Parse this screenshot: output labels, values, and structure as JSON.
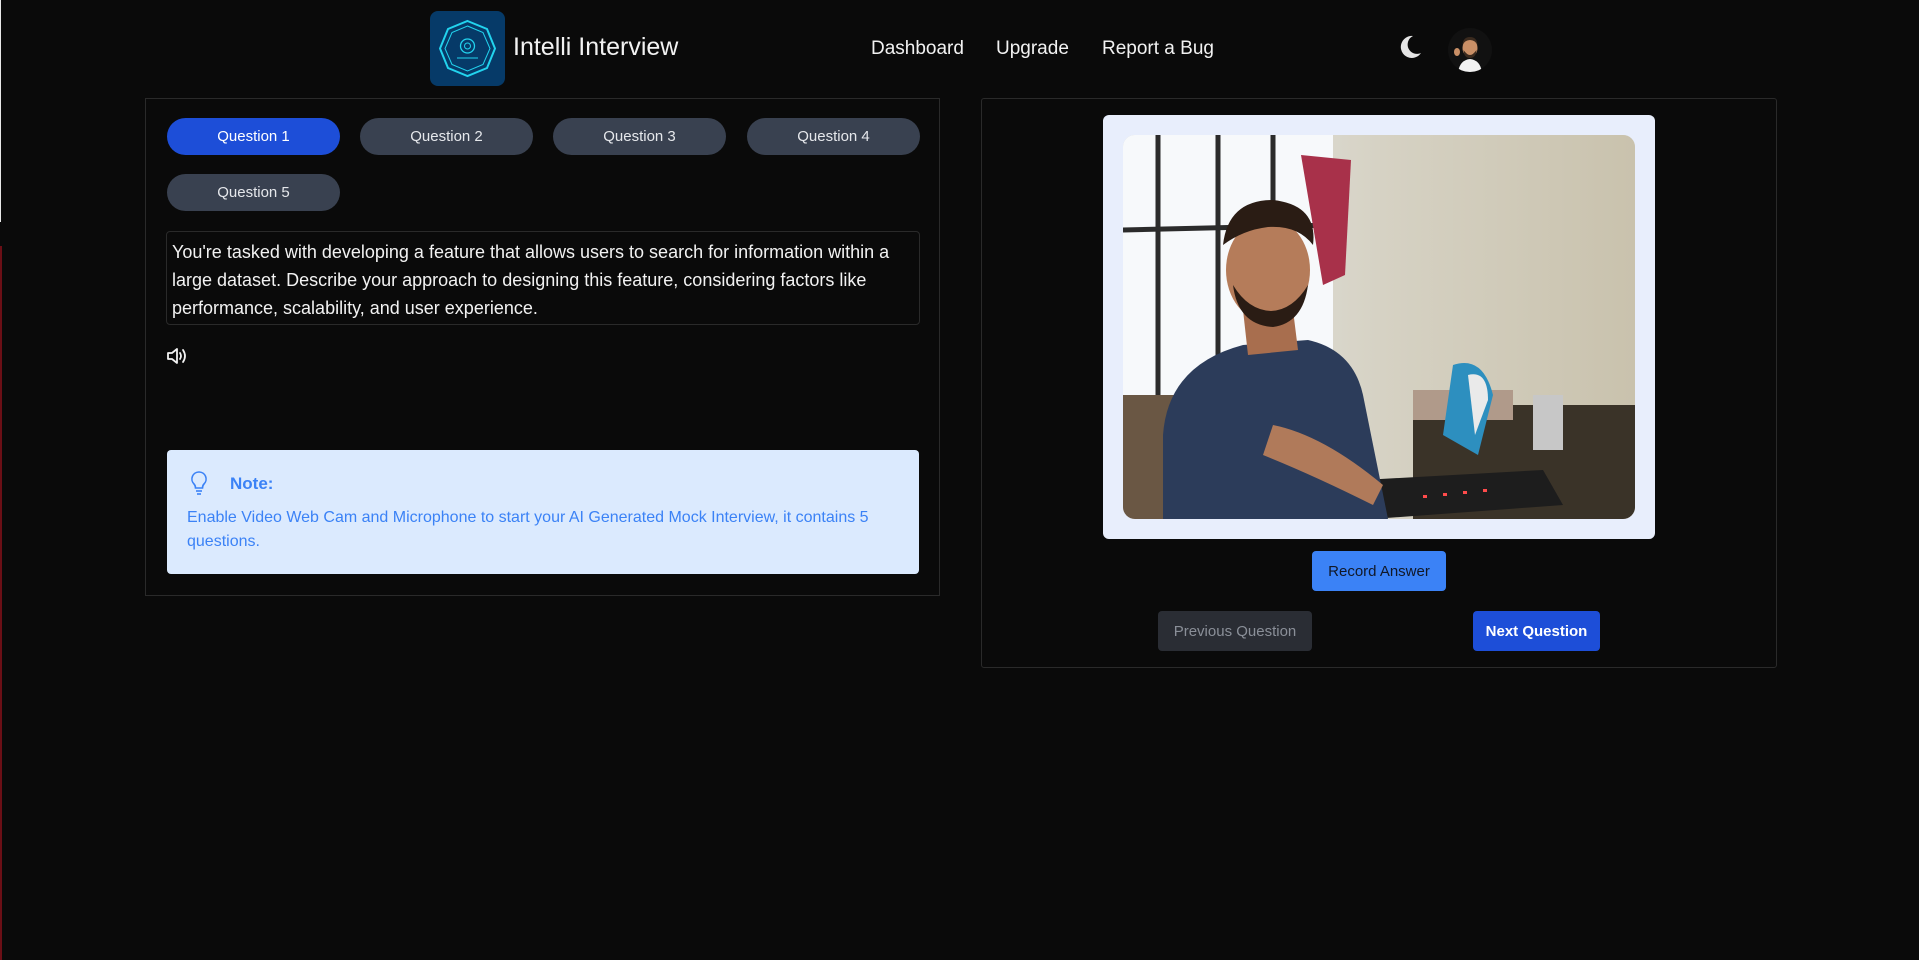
{
  "app": {
    "title": "Intelli Interview"
  },
  "nav": {
    "dashboard": "Dashboard",
    "upgrade": "Upgrade",
    "report_bug": "Report a Bug"
  },
  "questions": {
    "tabs": [
      "Question 1",
      "Question 2",
      "Question 3",
      "Question 4",
      "Question 5"
    ],
    "active_index": 0,
    "text": "You're tasked with developing a feature that allows users to search for information within a large dataset. Describe your approach to designing this feature, considering factors like performance, scalability, and user experience."
  },
  "note": {
    "title": "Note:",
    "body": "Enable Video Web Cam and Microphone to start your AI Generated Mock Interview, it contains 5 questions."
  },
  "controls": {
    "record": "Record Answer",
    "previous": "Previous Question",
    "next": "Next Question"
  },
  "icons": {
    "logo": "brand-logo-icon",
    "theme": "moon-icon",
    "speaker": "speaker-icon",
    "note": "lightbulb-icon"
  },
  "colors": {
    "background": "#0a0a0a",
    "active_tab": "#1d4ed8",
    "inactive_tab": "#394150",
    "note_bg": "#dbeafe",
    "note_text": "#3b82f6",
    "next_button": "#1d4ed8",
    "record_button": "#3b82f6"
  }
}
